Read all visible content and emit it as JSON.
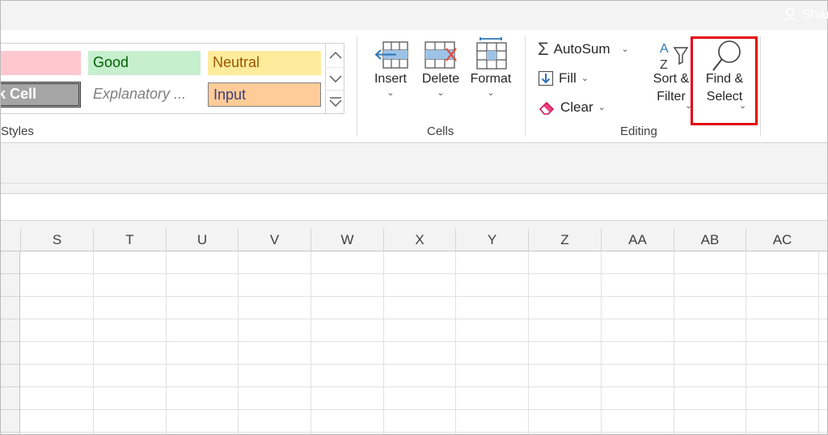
{
  "window": {
    "share_label": "Shar"
  },
  "styles_group": {
    "label": "Styles",
    "cells": {
      "bad": "",
      "good": "Good",
      "neutral": "Neutral",
      "check_cell": "ck Cell",
      "explanatory": "Explanatory ...",
      "input": "Input"
    }
  },
  "cells_group": {
    "label": "Cells",
    "insert": "Insert",
    "delete": "Delete",
    "format": "Format"
  },
  "editing_group": {
    "label": "Editing",
    "autosum": "AutoSum",
    "fill": "Fill",
    "clear": "Clear",
    "sort_filter_line1": "Sort &",
    "sort_filter_line2": "Filter",
    "find_select_line1": "Find &",
    "find_select_line2": "Select"
  },
  "columns": [
    "S",
    "T",
    "U",
    "V",
    "W",
    "X",
    "Y",
    "Z",
    "AA",
    "AB",
    "AC"
  ],
  "colors": {
    "highlight": "#e3000f",
    "accent_blue": "#2e75b6",
    "clear_pink": "#c2185b"
  }
}
